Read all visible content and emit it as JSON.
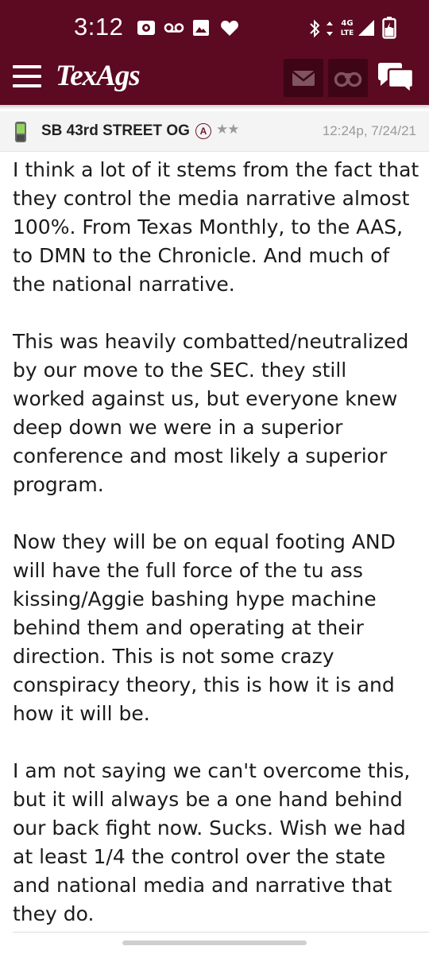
{
  "status_bar": {
    "time": "3:12",
    "network": "4G LTE"
  },
  "app_bar": {
    "logo": "TexAgs",
    "icons": [
      "menu-icon",
      "mail-icon",
      "binoculars-icon",
      "chat-icon"
    ]
  },
  "post": {
    "username": "SB 43rd STREET OG",
    "badge": "A",
    "stars": "★★",
    "timestamp": "12:24p, 7/24/21",
    "paragraphs": [
      "I think a lot of it stems from the fact that they control the media narrative almost 100%. From Texas Monthly, to the AAS, to DMN to the Chronicle. And much of the national narrative.",
      "This was heavily combatted/neutralized by our move to the SEC. they still worked against us, but everyone knew deep down we were in a superior conference and most likely a superior program.",
      "Now they will be on equal footing AND will have the full force of the tu ass kissing/Aggie bashing hype machine behind them and operating at their direction. This is not some crazy conspiracy theory, this is how it is and how it will be.",
      "I am not saying we can't overcome this, but it will always be a one hand behind our back fight now. Sucks. Wish we had at least 1/4 the control over the state and national media and narrative that they do."
    ]
  },
  "colors": {
    "brand": "#5b0a21",
    "brand_dark": "#3e0516",
    "header_bg": "#f4f4f4",
    "muted_text": "#9a9a9a"
  }
}
